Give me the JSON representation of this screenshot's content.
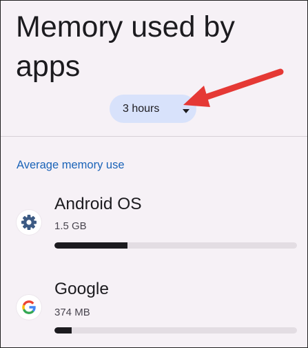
{
  "page": {
    "title": "Memory used by apps"
  },
  "time_range": {
    "selected": "3 hours",
    "icon": "arrow-drop-down-icon"
  },
  "section": {
    "header": "Average memory use"
  },
  "apps": [
    {
      "name": "Android OS",
      "size": "1.5 GB",
      "usage_fraction": 0.3,
      "icon": "gear-icon",
      "icon_color": "#3c5a83"
    },
    {
      "name": "Google",
      "size": "374 MB",
      "usage_fraction": 0.07,
      "icon": "google-g-icon"
    }
  ],
  "annotation": {
    "arrow_color": "#e53935"
  },
  "colors": {
    "background": "#f6f1f6",
    "chip": "#d8e2fb",
    "accent": "#1a63b8",
    "bar_track": "#e3dde3",
    "bar_fill": "#1c1b1f"
  }
}
